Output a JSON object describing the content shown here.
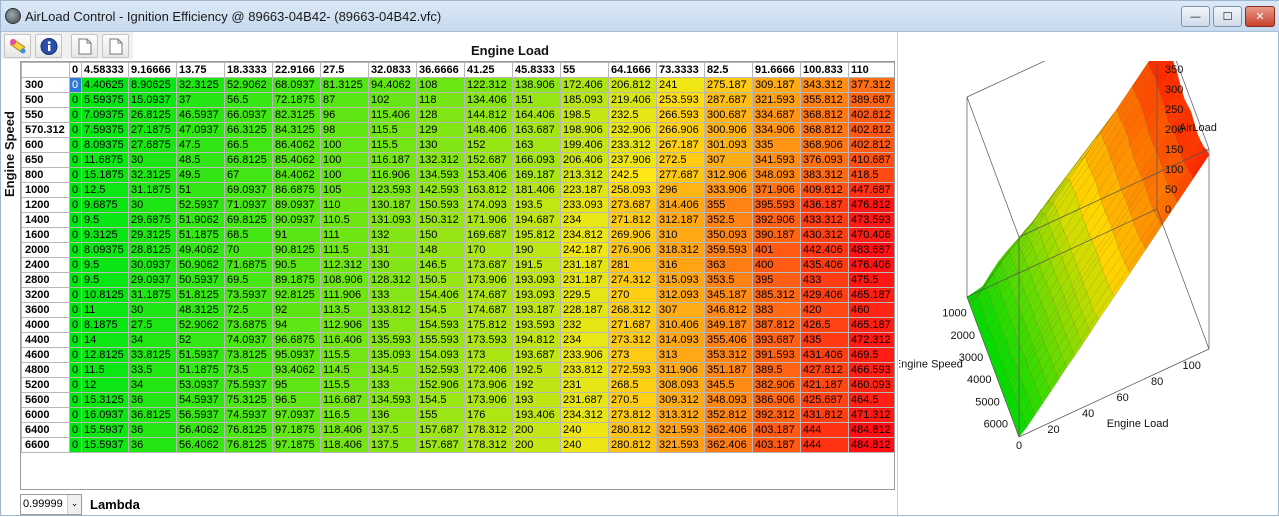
{
  "window": {
    "title": "AirLoad Control - Ignition Efficiency @ 89663-04B42- (89663-04B42.vfc)",
    "minimize_glyph": "—",
    "maximize_glyph": "☐",
    "close_glyph": "✕"
  },
  "toolbar": {
    "buttons": [
      {
        "icon": "wand-icon"
      },
      {
        "icon": "info-icon"
      },
      {
        "icon": "document-icon"
      },
      {
        "icon": "document-icon"
      }
    ]
  },
  "table": {
    "column_axis_label": "Engine Load",
    "row_axis_label": "Engine Speed",
    "columns": [
      "0",
      "4.58333",
      "9.16666",
      "13.75",
      "18.3333",
      "22.9166",
      "27.5",
      "32.0833",
      "36.6666",
      "41.25",
      "45.8333",
      "55",
      "64.1666",
      "73.3333",
      "82.5",
      "91.6666",
      "100.833",
      "110"
    ],
    "rows": [
      {
        "label": "300",
        "values": [
          "0",
          "4.40625",
          "8.90625",
          "32.3125",
          "52.9062",
          "68.0937",
          "81.3125",
          "94.4062",
          "108",
          "122.312",
          "138.906",
          "172.406",
          "206.812",
          "241",
          "275.187",
          "309.187",
          "343.312",
          "377.312"
        ]
      },
      {
        "label": "500",
        "values": [
          "0",
          "5.59375",
          "15.0937",
          "37",
          "56.5",
          "72.1875",
          "87",
          "102",
          "118",
          "134.406",
          "151",
          "185.093",
          "219.406",
          "253.593",
          "287.687",
          "321.593",
          "355.812",
          "389.687"
        ]
      },
      {
        "label": "550",
        "values": [
          "0",
          "7.09375",
          "26.8125",
          "46.5937",
          "66.0937",
          "82.3125",
          "96",
          "115.406",
          "128",
          "144.812",
          "164.406",
          "198.5",
          "232.5",
          "266.593",
          "300.687",
          "334.687",
          "368.812",
          "402.812"
        ]
      },
      {
        "label": "570.312",
        "values": [
          "0",
          "7.59375",
          "27.1875",
          "47.0937",
          "66.3125",
          "84.3125",
          "98",
          "115.5",
          "129",
          "148.406",
          "163.687",
          "198.906",
          "232.906",
          "266.906",
          "300.906",
          "334.906",
          "368.812",
          "402.812"
        ]
      },
      {
        "label": "600",
        "values": [
          "0",
          "8.09375",
          "27.6875",
          "47.5",
          "66.5",
          "86.4062",
          "100",
          "115.5",
          "130",
          "152",
          "163",
          "199.406",
          "233.312",
          "267.187",
          "301.093",
          "335",
          "368.906",
          "402.812"
        ]
      },
      {
        "label": "650",
        "values": [
          "0",
          "11.6875",
          "30",
          "48.5",
          "66.8125",
          "85.4062",
          "100",
          "116.187",
          "132.312",
          "152.687",
          "166.093",
          "206.406",
          "237.906",
          "272.5",
          "307",
          "341.593",
          "376.093",
          "410.687"
        ]
      },
      {
        "label": "800",
        "values": [
          "0",
          "15.1875",
          "32.3125",
          "49.5",
          "67",
          "84.4062",
          "100",
          "116.906",
          "134.593",
          "153.406",
          "169.187",
          "213.312",
          "242.5",
          "277.687",
          "312.906",
          "348.093",
          "383.312",
          "418.5"
        ]
      },
      {
        "label": "1000",
        "values": [
          "0",
          "12.5",
          "31.1875",
          "51",
          "69.0937",
          "86.6875",
          "105",
          "123.593",
          "142.593",
          "163.812",
          "181.406",
          "223.187",
          "258.093",
          "296",
          "333.906",
          "371.906",
          "409.812",
          "447.687"
        ]
      },
      {
        "label": "1200",
        "values": [
          "0",
          "9.6875",
          "30",
          "52.5937",
          "71.0937",
          "89.0937",
          "110",
          "130.187",
          "150.593",
          "174.093",
          "193.5",
          "233.093",
          "273.687",
          "314.406",
          "355",
          "395.593",
          "436.187",
          "476.812"
        ]
      },
      {
        "label": "1400",
        "values": [
          "0",
          "9.5",
          "29.6875",
          "51.9062",
          "69.8125",
          "90.0937",
          "110.5",
          "131.093",
          "150.312",
          "171.906",
          "194.687",
          "234",
          "271.812",
          "312.187",
          "352.5",
          "392.906",
          "433.312",
          "473.593"
        ]
      },
      {
        "label": "1600",
        "values": [
          "0",
          "9.3125",
          "29.3125",
          "51.1875",
          "68.5",
          "91",
          "111",
          "132",
          "150",
          "169.687",
          "195.812",
          "234.812",
          "269.906",
          "310",
          "350.093",
          "390.187",
          "430.312",
          "470.406"
        ]
      },
      {
        "label": "2000",
        "values": [
          "0",
          "8.09375",
          "28.8125",
          "49.4062",
          "70",
          "90.8125",
          "111.5",
          "131",
          "148",
          "170",
          "190",
          "242.187",
          "276.906",
          "318.312",
          "359.593",
          "401",
          "442.406",
          "483.687"
        ]
      },
      {
        "label": "2400",
        "values": [
          "0",
          "9.5",
          "30.0937",
          "50.9062",
          "71.6875",
          "90.5",
          "112.312",
          "130",
          "146.5",
          "173.687",
          "191.5",
          "231.187",
          "281",
          "316",
          "363",
          "400",
          "435.406",
          "476.406"
        ]
      },
      {
        "label": "2800",
        "values": [
          "0",
          "9.5",
          "29.0937",
          "50.5937",
          "69.5",
          "89.1875",
          "108.906",
          "128.312",
          "150.5",
          "173.906",
          "193.093",
          "231.187",
          "274.312",
          "315.093",
          "353.5",
          "395",
          "433",
          "475.5"
        ]
      },
      {
        "label": "3200",
        "values": [
          "0",
          "10.8125",
          "31.1875",
          "51.8125",
          "73.5937",
          "92.8125",
          "111.906",
          "133",
          "154.406",
          "174.687",
          "193.093",
          "229.5",
          "270",
          "312.093",
          "345.187",
          "385.312",
          "429.406",
          "465.187"
        ]
      },
      {
        "label": "3600",
        "values": [
          "0",
          "11",
          "30",
          "48.3125",
          "72.5",
          "92",
          "113.5",
          "133.812",
          "154.5",
          "174.687",
          "193.187",
          "228.187",
          "268.312",
          "307",
          "346.812",
          "383",
          "420",
          "460"
        ]
      },
      {
        "label": "4000",
        "values": [
          "0",
          "8.1875",
          "27.5",
          "52.9062",
          "73.6875",
          "94",
          "112.906",
          "135",
          "154.593",
          "175.812",
          "193.593",
          "232",
          "271.687",
          "310.406",
          "349.187",
          "387.812",
          "426.5",
          "465.187"
        ]
      },
      {
        "label": "4400",
        "values": [
          "0",
          "14",
          "34",
          "52",
          "74.0937",
          "96.6875",
          "116.406",
          "135.593",
          "155.593",
          "173.593",
          "194.812",
          "234",
          "273.312",
          "314.093",
          "355.406",
          "393.687",
          "435",
          "472.312"
        ]
      },
      {
        "label": "4600",
        "values": [
          "0",
          "12.8125",
          "33.8125",
          "51.5937",
          "73.8125",
          "95.0937",
          "115.5",
          "135.093",
          "154.093",
          "173",
          "193.687",
          "233.906",
          "273",
          "313",
          "353.312",
          "391.593",
          "431.406",
          "469.5"
        ]
      },
      {
        "label": "4800",
        "values": [
          "0",
          "11.5",
          "33.5",
          "51.1875",
          "73.5",
          "93.4062",
          "114.5",
          "134.5",
          "152.593",
          "172.406",
          "192.5",
          "233.812",
          "272.593",
          "311.906",
          "351.187",
          "389.5",
          "427.812",
          "466.593"
        ]
      },
      {
        "label": "5200",
        "values": [
          "0",
          "12",
          "34",
          "53.0937",
          "75.5937",
          "95",
          "115.5",
          "133",
          "152.906",
          "173.906",
          "192",
          "231",
          "268.5",
          "308.093",
          "345.5",
          "382.906",
          "421.187",
          "460.093"
        ]
      },
      {
        "label": "5600",
        "values": [
          "0",
          "15.3125",
          "36",
          "54.5937",
          "75.3125",
          "96.5",
          "116.687",
          "134.593",
          "154.5",
          "173.906",
          "193",
          "231.687",
          "270.5",
          "309.312",
          "348.093",
          "386.906",
          "425.687",
          "464.5"
        ]
      },
      {
        "label": "6000",
        "values": [
          "0",
          "16.0937",
          "36.8125",
          "56.5937",
          "74.5937",
          "97.0937",
          "116.5",
          "136",
          "155",
          "176",
          "193.406",
          "234.312",
          "273.812",
          "313.312",
          "352.812",
          "392.312",
          "431.812",
          "471.312"
        ]
      },
      {
        "label": "6400",
        "values": [
          "0",
          "15.5937",
          "36",
          "56.4062",
          "76.8125",
          "97.1875",
          "118.406",
          "137.5",
          "157.687",
          "178.312",
          "200",
          "240",
          "280.812",
          "321.593",
          "362.406",
          "403.187",
          "444",
          "484.812"
        ]
      },
      {
        "label": "6600",
        "values": [
          "0",
          "15.5937",
          "36",
          "56.4062",
          "76.8125",
          "97.1875",
          "118.406",
          "137.5",
          "157.687",
          "178.312",
          "200",
          "240",
          "280.812",
          "321.593",
          "362.406",
          "403.187",
          "444",
          "484.812"
        ]
      }
    ],
    "selected_cell": {
      "row": 0,
      "col": 0
    },
    "color_scale": {
      "low": "#00e000",
      "mid_yellow": "#f2f200",
      "high": "#ff1a1a",
      "max_value": 484.812
    }
  },
  "lambda": {
    "value": "0.99999",
    "label": "Lambda",
    "chevron": "⌄"
  },
  "plot3d": {
    "z_label": "AirLoad",
    "y_label": "Engine Speed",
    "x_label": "Engine Load",
    "z_ticks": [
      "450",
      "400",
      "350",
      "300",
      "250",
      "200",
      "150",
      "100",
      "50",
      "0"
    ],
    "y_ticks": [
      "1000",
      "2000",
      "3000",
      "4000",
      "5000",
      "6000"
    ],
    "x_ticks": [
      "0",
      "20",
      "40",
      "60",
      "80",
      "100"
    ]
  }
}
